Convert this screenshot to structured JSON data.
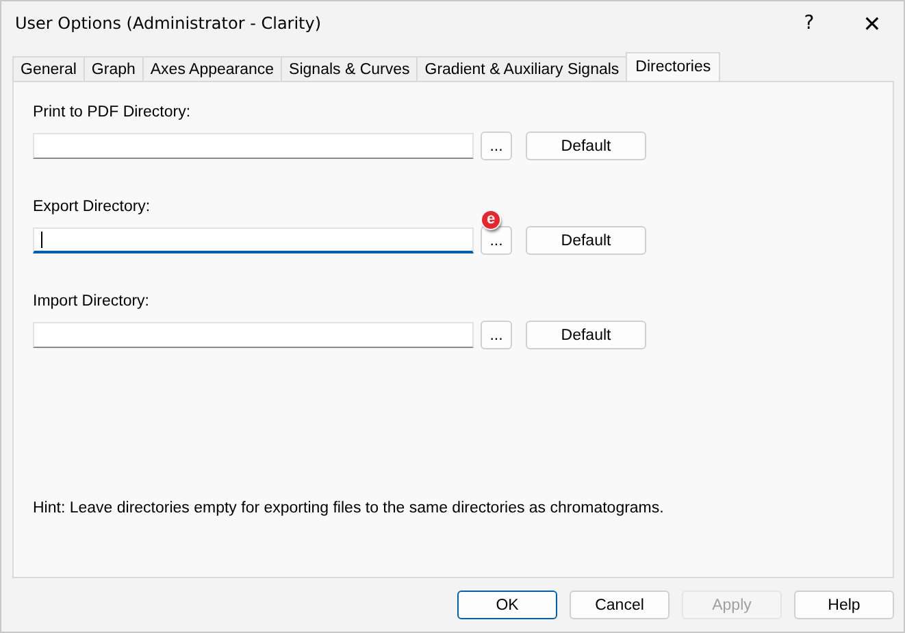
{
  "window": {
    "title": "User Options (Administrator - Clarity)",
    "help_glyph": "?",
    "close_glyph": "✕"
  },
  "tabs": [
    {
      "label": "General",
      "selected": false
    },
    {
      "label": "Graph",
      "selected": false
    },
    {
      "label": "Axes Appearance",
      "selected": false
    },
    {
      "label": "Signals & Curves",
      "selected": false
    },
    {
      "label": "Gradient & Auxiliary Signals",
      "selected": false
    },
    {
      "label": "Directories",
      "selected": true
    }
  ],
  "directories": [
    {
      "label": "Print to PDF Directory:",
      "focused": false,
      "browse": "...",
      "default": "Default"
    },
    {
      "label": "Export Directory:",
      "focused": true,
      "browse": "...",
      "default": "Default",
      "badge": "e"
    },
    {
      "label": "Import Directory:",
      "focused": false,
      "browse": "...",
      "default": "Default"
    }
  ],
  "hint": "Hint: Leave directories empty for exporting files to the same directories as chromatograms.",
  "buttons": [
    {
      "label": "OK",
      "kind": "default",
      "disabled": false
    },
    {
      "label": "Cancel",
      "kind": "normal",
      "disabled": false
    },
    {
      "label": "Apply",
      "kind": "normal",
      "disabled": true
    },
    {
      "label": "Help",
      "kind": "normal",
      "disabled": false
    }
  ]
}
